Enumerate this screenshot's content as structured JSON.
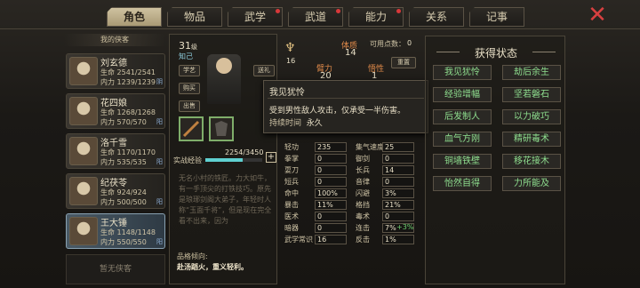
{
  "tabs": [
    "角色",
    "物品",
    "武学",
    "武道",
    "能力",
    "关系",
    "记事"
  ],
  "side_header": "我的侠客",
  "characters": [
    {
      "name": "刘玄德",
      "hp": "2541/2541",
      "mp": "1239/1239",
      "tag": "阴"
    },
    {
      "name": "花四娘",
      "hp": "1268/1268",
      "mp": "570/570",
      "tag": "阳"
    },
    {
      "name": "洛千雪",
      "hp": "1170/1170",
      "mp": "535/535",
      "tag": "阳"
    },
    {
      "name": "纪茯苓",
      "hp": "924/924",
      "mp": "500/500",
      "tag": "阳"
    },
    {
      "name": "王大锤",
      "hp": "1148/1148",
      "mp": "550/550",
      "tag": "阳"
    }
  ],
  "labels": {
    "hp": "生命",
    "mp": "内力"
  },
  "no_hero": "暂无侠客",
  "profile": {
    "level": "31",
    "level_unit": "级",
    "relation": "知己",
    "buttons": [
      "学艺",
      "送礼",
      "购买",
      "出售"
    ],
    "exp_label": "实战经验",
    "exp": "2254/3450",
    "exp_fraction": 0.653,
    "desc": "无名小村的铁匠。力大如牛，有一手顶尖的打铁技巧。原先是琅琊剑阁大弟子，年轻时人称“玉面千将”，但是现在完全看不出来，因为",
    "pin_label": "品格倾向:",
    "pin_value": "赴汤蹈火，重义轻利。"
  },
  "attr_top": {
    "talent": "16",
    "constitution_label": "体质",
    "constitution": "14",
    "free_label": "可用点数：",
    "free": "0",
    "arm_label": "臂力",
    "arm": "20",
    "wisdom_label": "悟性",
    "wisdom": "1",
    "reset": "重置"
  },
  "stats": [
    {
      "l": "轻功",
      "v": "235",
      "l2": "集气速度",
      "v2": "25"
    },
    {
      "l": "拳掌",
      "v": "0",
      "l2": "御剑",
      "v2": "0"
    },
    {
      "l": "耍刀",
      "v": "0",
      "l2": "长兵",
      "v2": "14"
    },
    {
      "l": "短兵",
      "v": "0",
      "l2": "音律",
      "v2": "0"
    },
    {
      "l": "命中",
      "v": "100%",
      "l2": "闪避",
      "v2": "3%"
    },
    {
      "l": "暴击",
      "v": "11%",
      "l2": "格挡",
      "v2": "21%"
    },
    {
      "l": "医术",
      "v": "0",
      "l2": "毒术",
      "v2": "0"
    },
    {
      "l": "暗器",
      "v": "0",
      "l2": "连击",
      "v2": "7%",
      "extra": "+3%"
    },
    {
      "l": "武学常识",
      "v": "16",
      "l2": "反击",
      "v2": "1%"
    }
  ],
  "tooltip": {
    "title": "我见犹怜",
    "desc": "受到男性敌人攻击，仅承受一半伤害。",
    "duration_label": "持续时间",
    "duration": "永久"
  },
  "right": {
    "title": "获得状态",
    "statuses": [
      "我见犹怜",
      "劫后余生",
      "经验增幅",
      "坚若磐石",
      "后发制人",
      "以力破巧",
      "血气方刚",
      "精研毒术",
      "铜墙铁壁",
      "移花接木",
      "怡然自得",
      "力所能及"
    ]
  }
}
